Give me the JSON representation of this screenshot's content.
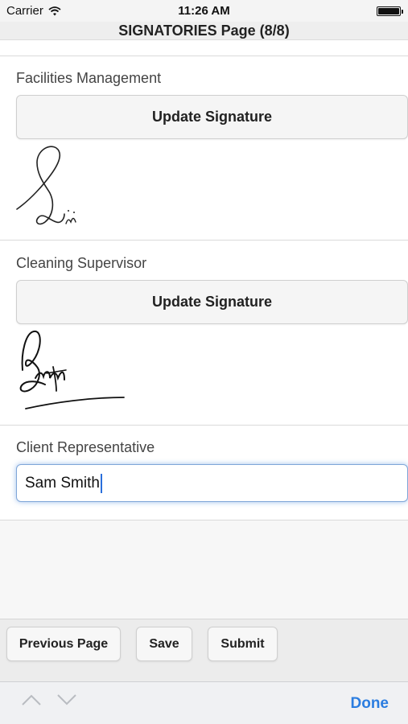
{
  "status_bar": {
    "carrier": "Carrier",
    "time": "11:26 AM",
    "battery_level": 1.0
  },
  "header": {
    "title": "SIGNATORIES Page (8/8)"
  },
  "sections": [
    {
      "label": "Facilities Management",
      "button_label": "Update Signature",
      "signature": "handwritten-signature"
    },
    {
      "label": "Cleaning Supervisor",
      "button_label": "Update Signature",
      "signature": "handwritten-signature"
    },
    {
      "label": "Client Representative",
      "input_value": "Sam Smith"
    }
  ],
  "footer": {
    "previous_label": "Previous Page",
    "save_label": "Save",
    "submit_label": "Submit"
  },
  "keyboard_toolbar": {
    "up_icon": "chevron-up-icon",
    "down_icon": "chevron-down-icon",
    "done_label": "Done"
  },
  "colors": {
    "accent": "#2b7de0",
    "focus_border": "#7fa6d8"
  }
}
